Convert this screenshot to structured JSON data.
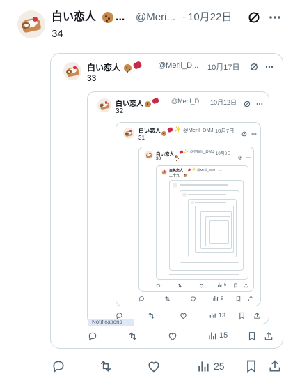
{
  "tweet": {
    "name": "白い恋人",
    "name_suffix": "...",
    "handle": "@Meri...",
    "sep": "·",
    "date": "10月22日",
    "text": "34",
    "reply_count": "",
    "retweet_count": "",
    "like_count": "",
    "views": "25"
  },
  "quote1": {
    "name": "白い恋人",
    "handle": "@Meril_D...",
    "date": "10月17日",
    "text": "33",
    "views": "15"
  },
  "quote2": {
    "name": "白い恋人",
    "handle": "@Meril_D...",
    "date": "10月12日",
    "text": "32",
    "views": "13"
  },
  "quote3": {
    "name": "白い恋人",
    "handle": "@Meril_DMJ",
    "date": "10月7日",
    "text": "31",
    "views": "8"
  },
  "quote4": {
    "name": "白い恋人",
    "handle": "@Meril_DMJ",
    "date": "10月8日",
    "text": "30",
    "views": "5"
  },
  "quote5": {
    "name": "白色恋人",
    "handle": "@Meril_DMJ",
    "date": "...",
    "text": "二十九"
  },
  "notifications_label": "Notifications",
  "colors": {
    "text": "#0f1419",
    "muted": "#536471",
    "border": "#cfd9de",
    "accent": "#1d9bf0"
  }
}
